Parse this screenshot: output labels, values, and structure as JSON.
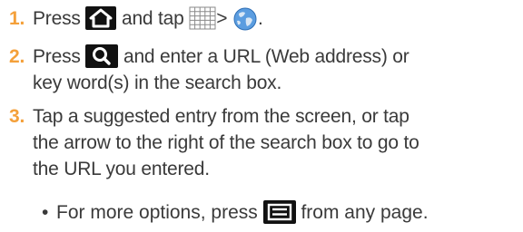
{
  "steps": [
    {
      "number": "1.",
      "text_a": "Press",
      "text_b": "and tap",
      "text_c": ">",
      "text_d": ".",
      "icons": [
        "home-key-icon",
        "applications-grid-icon",
        "internet-globe-icon"
      ]
    },
    {
      "number": "2.",
      "text_a": "Press",
      "text_b": "and enter a URL (Web address) or",
      "line2": "key word(s) in the search box.",
      "icons": [
        "search-key-icon"
      ]
    },
    {
      "number": "3.",
      "line1": "Tap a suggested entry from the screen, or tap",
      "line2": "the arrow to the right of the search box to go to",
      "line3": "the URL you entered."
    }
  ],
  "bullet": {
    "symbol": "•",
    "text_a": "For more options, press",
    "text_b": "from any page.",
    "icons": [
      "menu-key-icon"
    ]
  },
  "colors": {
    "step_number": "#f4a03a",
    "body_text": "#3a3a3a",
    "key_background": "#111111"
  }
}
